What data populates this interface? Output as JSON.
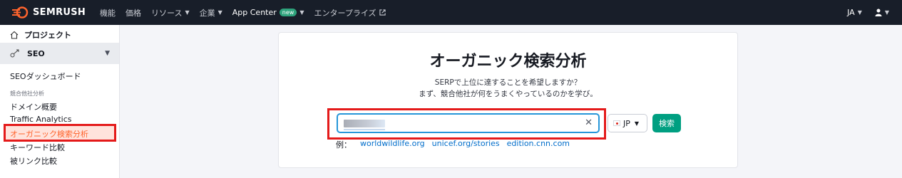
{
  "brand": {
    "name": "SEMRUSH",
    "color": "#ff642d"
  },
  "topnav": {
    "items": [
      {
        "label": "機能",
        "has_menu": false
      },
      {
        "label": "価格",
        "has_menu": false
      },
      {
        "label": "リソース",
        "has_menu": true
      },
      {
        "label": "企業",
        "has_menu": true
      }
    ],
    "app_center": {
      "label": "App Center",
      "badge": "new"
    },
    "enterprise": {
      "label": "エンタープライズ",
      "icon": "external-link-icon"
    },
    "language": "JA",
    "user_icon": "user-icon"
  },
  "sidebar": {
    "project": "プロジェクト",
    "seo_section": "SEO",
    "dashboard": "SEOダッシュボード",
    "group_label": "競合他社分析",
    "items": [
      "ドメイン概要",
      "Traffic Analytics",
      "オーガニック検索分析",
      "キーワード比較",
      "被リンク比較"
    ],
    "active_item": "オーガニック検索分析"
  },
  "main": {
    "title": "オーガニック検索分析",
    "subtitle_line1": "SERPで上位に達することを希望しますか？",
    "subtitle_line2": "まず、競合他社が何をうまくやっているのかを学び。",
    "search": {
      "value": "",
      "clear_icon": "close-icon"
    },
    "database": {
      "label": "JP",
      "flag": "japan-flag-icon"
    },
    "search_button": "検索",
    "examples_label": "例：",
    "examples": [
      "worldwildlife.org",
      "unicef.org/stories",
      "edition.cnn.com"
    ]
  },
  "colors": {
    "accent": "#009f81",
    "link": "#006dca",
    "highlight": "#e41a1a",
    "topbar": "#181e29"
  }
}
